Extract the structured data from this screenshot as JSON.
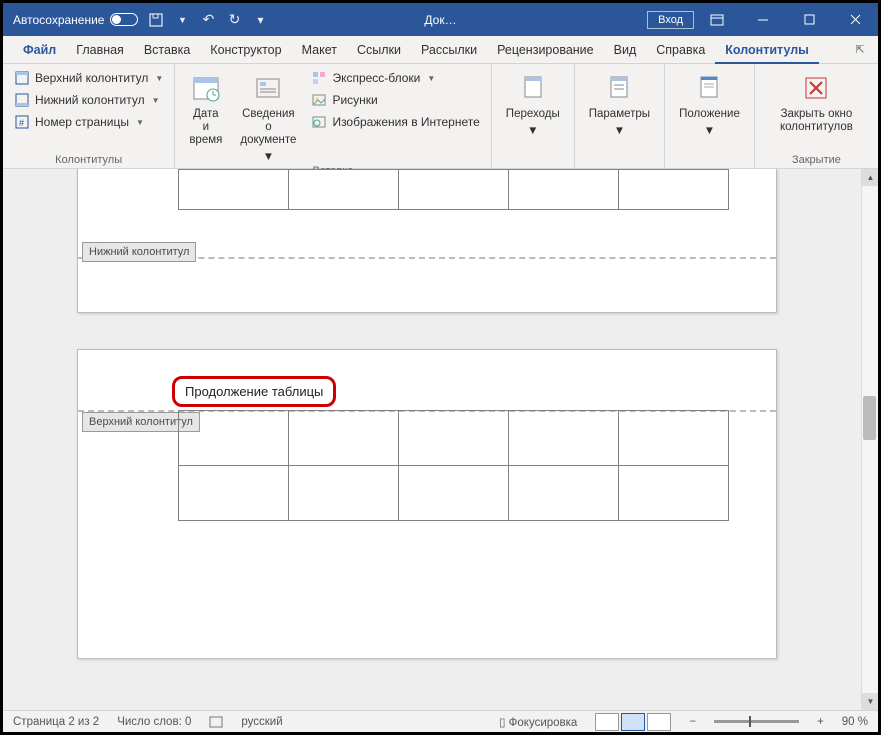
{
  "titlebar": {
    "autosave": "Автосохранение",
    "doc_title": "Док…",
    "signin": "Вход"
  },
  "tabs": {
    "file": "Файл",
    "home": "Главная",
    "insert": "Вставка",
    "design": "Конструктор",
    "layout": "Макет",
    "references": "Ссылки",
    "mailings": "Рассылки",
    "review": "Рецензирование",
    "view": "Вид",
    "help": "Справка",
    "header_footer": "Колонтитулы"
  },
  "ribbon": {
    "g1": {
      "header": "Верхний колонтитул",
      "footer": "Нижний колонтитул",
      "page_num": "Номер страницы",
      "group_label": "Колонтитулы"
    },
    "g2": {
      "date_time": "Дата и\nвремя",
      "doc_info": "Сведения о\nдокументе",
      "express": "Экспресс-блоки",
      "pictures": "Рисунки",
      "online_pic": "Изображения в Интернете",
      "group_label": "Вставка"
    },
    "g3": {
      "navigation": "Переходы"
    },
    "g4": {
      "options": "Параметры"
    },
    "g5": {
      "position": "Положение"
    },
    "g6": {
      "close": "Закрыть окно\nколонтитулов",
      "group_label": "Закрытие"
    }
  },
  "document": {
    "footer_tag": "Нижний колонтитул",
    "header_tag": "Верхний колонтитул",
    "continuation": "Продолжение таблицы"
  },
  "statusbar": {
    "page": "Страница 2 из 2",
    "words": "Число слов: 0",
    "lang": "русский",
    "focus": "Фокусировка",
    "zoom": "90 %"
  }
}
